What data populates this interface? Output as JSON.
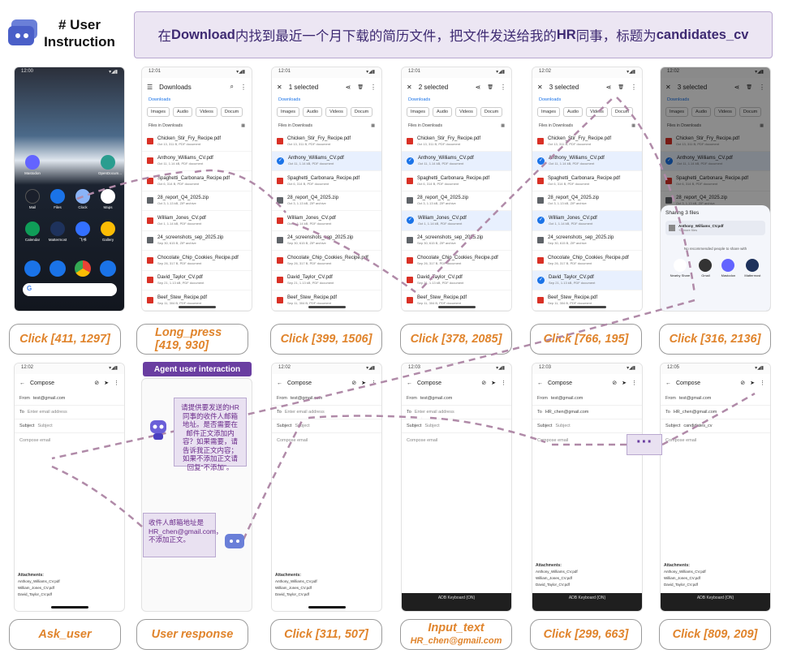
{
  "header": {
    "title_line1": "# User",
    "title_line2": "Instruction",
    "instruction_pre": "在",
    "instruction_b1": "Download",
    "instruction_mid": "内找到最近一个月下载的简历文件，把文件发送给我的",
    "instruction_b2": "HR",
    "instruction_mid2": "同事，标题为",
    "instruction_b3": "candidates_cv"
  },
  "status_times": [
    "12:00",
    "12:01",
    "12:01",
    "12:01",
    "12:02",
    "12:02",
    "12:02",
    "12:02",
    "12:03",
    "12:03",
    "12:05"
  ],
  "home": {
    "apps": [
      "Mastodon",
      "OpenDocum...",
      "Mail",
      "Files",
      "Clock",
      "Maps",
      "Calendar",
      "Mattermost",
      "飞书",
      "Gallery"
    ]
  },
  "files_screen": {
    "title": "Downloads",
    "selected_1": "1 selected",
    "selected_2": "2 selected",
    "selected_3": "3 selected",
    "link": "Downloads",
    "chips": [
      "Images",
      "Audio",
      "Videos",
      "Docum"
    ],
    "section": "Files in Downloads",
    "files": [
      {
        "name": "Chicken_Stir_Fry_Recipe.pdf",
        "meta": "Oct 13, 311 B, PDF document",
        "type": "pdf"
      },
      {
        "name": "Anthony_Williams_CV.pdf",
        "meta": "Oct 11, 1.14 kB, PDF document",
        "type": "pdf"
      },
      {
        "name": "Spaghetti_Carbonara_Recipe.pdf",
        "meta": "Oct 6, 314 B, PDF document",
        "type": "pdf"
      },
      {
        "name": "28_report_Q4_2025.zip",
        "meta": "Oct 3, 1.13 kB, ZIP archive",
        "type": "zip"
      },
      {
        "name": "William_Jones_CV.pdf",
        "meta": "Oct 1, 1.14 kB, PDF document",
        "type": "pdf"
      },
      {
        "name": "24_screenshots_sep_2025.zip",
        "meta": "Sep 30, 615 B, ZIP archive",
        "type": "zip"
      },
      {
        "name": "Chocolate_Chip_Cookies_Recipe.pdf",
        "meta": "Sep 26, 317 B, PDF document",
        "type": "pdf"
      },
      {
        "name": "David_Taylor_CV.pdf",
        "meta": "Sep 21, 1.13 kB, PDF document",
        "type": "pdf"
      },
      {
        "name": "Beef_Stew_Recipe.pdf",
        "meta": "Sep 11, 304 B, PDF document",
        "type": "pdf"
      }
    ]
  },
  "share": {
    "title": "Sharing 3 files",
    "file": "Anthony_Williams_CV.pdf",
    "more": "+2 more files",
    "note": "No recommended people to share with",
    "apps": [
      "Nearby Share",
      "Gmail",
      "Mastodon",
      "Mattermost"
    ]
  },
  "compose": {
    "title": "Compose",
    "from_label": "From",
    "from_value": "test@gmail.com",
    "to_label": "To",
    "to_placeholder": "Enter email address",
    "to_value": "HR_chen@gmail.com",
    "subject_label": "Subject",
    "subject_placeholder": "Subject",
    "subject_value": "candidates_cv",
    "body_placeholder": "Compose email",
    "attachments_title": "Attachments:",
    "attachments": [
      "Anthony_Williams_CV.pdf",
      "William_Jones_CV.pdf",
      "David_Taylor_CV.pdf"
    ],
    "keyboard": "ADB Keyboard {ON}"
  },
  "agent_badge": "Agent user interaction",
  "agent_question": "请提供要发送的HR同事的收件人邮箱地址。是否需要在邮件正文添加内容？如果需要，请告诉我正文内容；如果不添加正文请回复“不添加”。",
  "user_reply": "收件人邮箱地址是HR_chen@gmail.com，不添加正文。",
  "actions_row1": [
    "Click [411, 1297]",
    "Long_press [419, 930]",
    "Click [399, 1506]",
    "Click [378, 2085]",
    "Click [766, 195]",
    "Click [316, 2136]"
  ],
  "actions_row2": [
    "Ask_user",
    "User response",
    "Click [311, 507]",
    "Input_text",
    "Click [299, 663]",
    "Click [809, 209]"
  ],
  "input_text_value": "HR_chen@gmail.com",
  "colors": {
    "accent": "#6a3ea1",
    "label": "#e0842c",
    "selection": "#e8f0fe",
    "check": "#1a73e8"
  }
}
